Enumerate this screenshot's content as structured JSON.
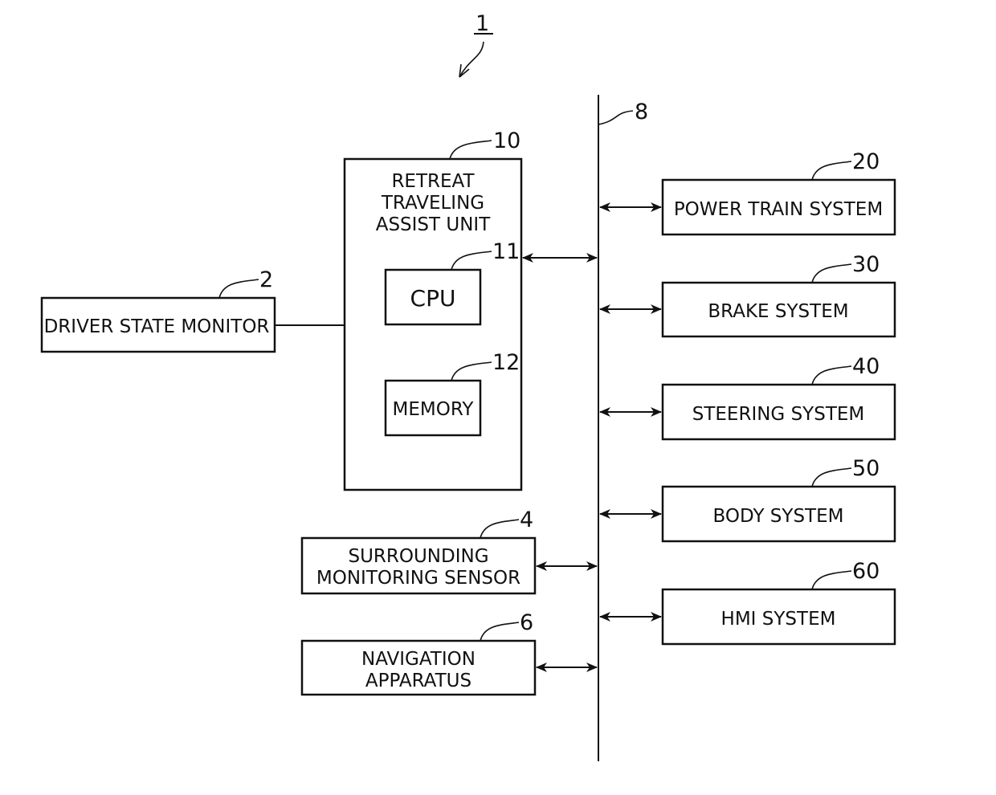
{
  "diagram": {
    "figure_ref": "1",
    "bus_ref": "8",
    "retreat_unit": {
      "ref": "10",
      "label_lines": [
        "RETREAT",
        "TRAVELING",
        "ASSIST UNIT"
      ],
      "cpu": {
        "ref": "11",
        "label": "CPU"
      },
      "memory": {
        "ref": "12",
        "label": "MEMORY"
      }
    },
    "driver_state_monitor": {
      "ref": "2",
      "label": "DRIVER STATE MONITOR"
    },
    "surrounding_sensor": {
      "ref": "4",
      "label_lines": [
        "SURROUNDING",
        "MONITORING SENSOR"
      ]
    },
    "navigation": {
      "ref": "6",
      "label_lines": [
        "NAVIGATION",
        "APPARATUS"
      ]
    },
    "systems": [
      {
        "ref": "20",
        "label": "POWER TRAIN SYSTEM"
      },
      {
        "ref": "30",
        "label": "BRAKE SYSTEM"
      },
      {
        "ref": "40",
        "label": "STEERING SYSTEM"
      },
      {
        "ref": "50",
        "label": "BODY SYSTEM"
      },
      {
        "ref": "60",
        "label": "HMI SYSTEM"
      }
    ]
  }
}
